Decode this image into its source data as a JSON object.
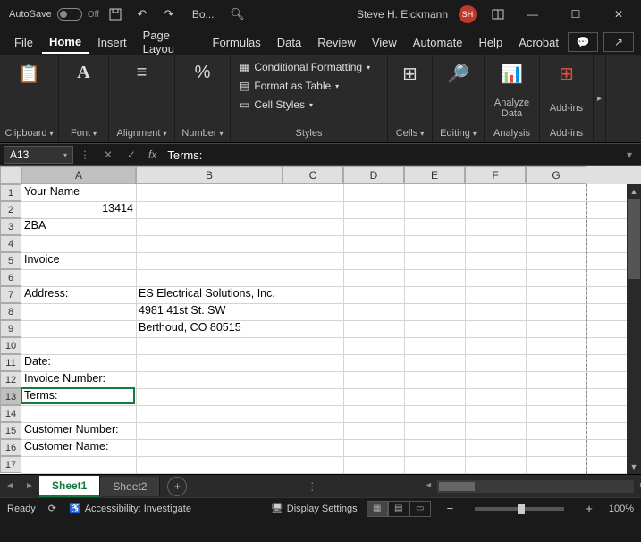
{
  "title": {
    "autosave": "AutoSave",
    "doc": "Bo...",
    "user": "Steve H. Eickmann",
    "initials": "SH"
  },
  "menu": {
    "file": "File",
    "home": "Home",
    "insert": "Insert",
    "page": "Page Layou",
    "formulas": "Formulas",
    "data": "Data",
    "review": "Review",
    "view": "View",
    "automate": "Automate",
    "help": "Help",
    "acrobat": "Acrobat"
  },
  "ribbon": {
    "clipboard": "Clipboard",
    "font": "Font",
    "alignment": "Alignment",
    "number": "Number",
    "cond": "Conditional Formatting",
    "fmt_table": "Format as Table",
    "cell_styles": "Cell Styles",
    "styles_label": "Styles",
    "cells": "Cells",
    "editing": "Editing",
    "analyze": "Analyze Data",
    "analysis_label": "Analysis",
    "addins": "Add-ins",
    "addins_label": "Add-ins"
  },
  "namebox": "A13",
  "formula": "Terms:",
  "cols": {
    "A": 128,
    "B": 164,
    "C": 68,
    "D": 68,
    "E": 68,
    "F": 68,
    "G": 68
  },
  "rows": 17,
  "cells": {
    "A1": "Your Name",
    "A2": "13414",
    "A3": "ZBA",
    "A5": "Invoice",
    "A7": "Address:",
    "B7": "ES Electrical Solutions, Inc.",
    "B8": "4981 41st St. SW",
    "B9": "Berthoud, CO 80515",
    "A11": "Date:",
    "A12": "Invoice Number:",
    "A13": "Terms:",
    "A15": "Customer Number:",
    "A16": "Customer Name:"
  },
  "right_align": [
    "A2"
  ],
  "selected": {
    "col": "A",
    "row": 13
  },
  "tabs": {
    "s1": "Sheet1",
    "s2": "Sheet2"
  },
  "status": {
    "ready": "Ready",
    "acc": "Accessibility: Investigate",
    "disp": "Display Settings",
    "zoom": "100%"
  }
}
